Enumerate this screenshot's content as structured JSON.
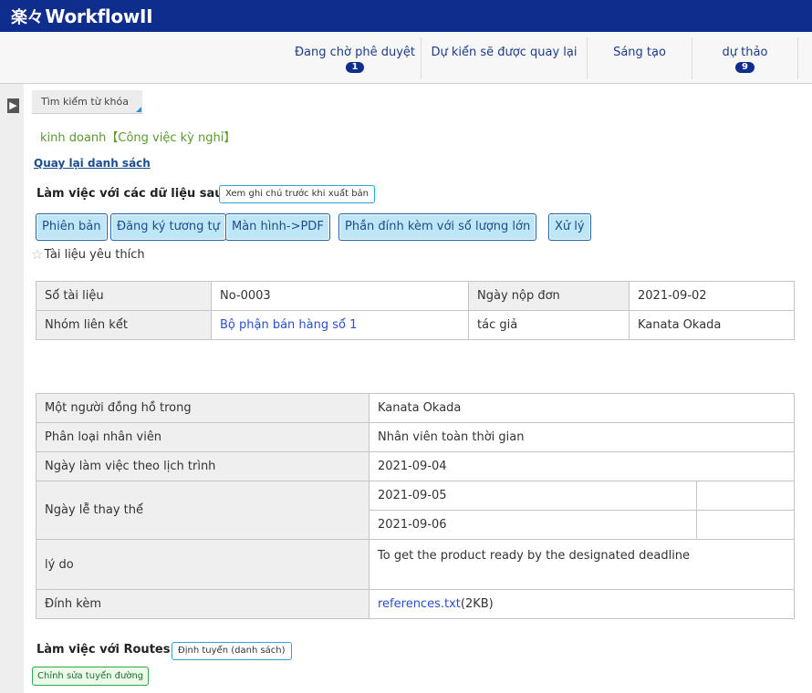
{
  "app": {
    "title": "WorkflowII",
    "logo_mark": "楽々"
  },
  "nav": {
    "items": [
      {
        "label": "Đang chờ phê duyệt",
        "badge": "1"
      },
      {
        "label": "Dự kiế́n sẽ được quay lại",
        "badge": ""
      },
      {
        "label": "Sáng tạo",
        "badge": ""
      },
      {
        "label": "dự thảo",
        "badge": "9"
      }
    ]
  },
  "search": {
    "label": "Tìm kiế́m từ khóa"
  },
  "category": "kinh doanh【Công việc kỳ nghỉ】",
  "back_link": "Quay lại danh sách",
  "work_with": {
    "label": "Làm việc với các dữ liệu sau:",
    "note_button": "Xem ghi chú trước khi xuấ́t bản",
    "buttons": [
      "Phiên bản",
      "Đăng ký tương tự",
      "Màn hình->PDF",
      "Phầ̀n đính kèm với số́ lượng lớn",
      "Xử lý"
    ]
  },
  "favorite": {
    "icon": "star-outline-icon",
    "label": "Tài liệu yêu thích"
  },
  "summary": {
    "doc_no_label": "Số́ tài liệu",
    "doc_no": "No-0003",
    "submit_date_label": "Ngày nộp đơn",
    "submit_date": "2021-09-02",
    "group_label": "Nhóm liên kế́t",
    "group": "Bộ phận bán hàng số́ 1",
    "author_label": "tác giả",
    "author": "Kanata Okada"
  },
  "details": {
    "contract_label": "Một người đồ̀ng hồ̀ trong",
    "contract": "Kanata Okada",
    "staff_type_label": "Phân loại nhân viên",
    "staff_type": "Nhân viên toàn thời gian",
    "scheduled_label": "Ngày làm việc theo lịch trình",
    "scheduled": "2021-09-04",
    "substitute_label": "Ngày lễ̃ thay thế́",
    "substitute_1": "2021-09-05",
    "substitute_2": "2021-09-06",
    "reason_label": "lý do",
    "reason": "To get  the product ready by the designated deadline",
    "attachment_label": "Đính kèm",
    "attachment_file": "references.txt",
    "attachment_size": "(2KB)"
  },
  "routes": {
    "label": "Làm việc với Routes:",
    "list_button": "Định tuyế́n (danh sách)",
    "edit_button": "Chỉnh sửa tuyế́n đường"
  }
}
